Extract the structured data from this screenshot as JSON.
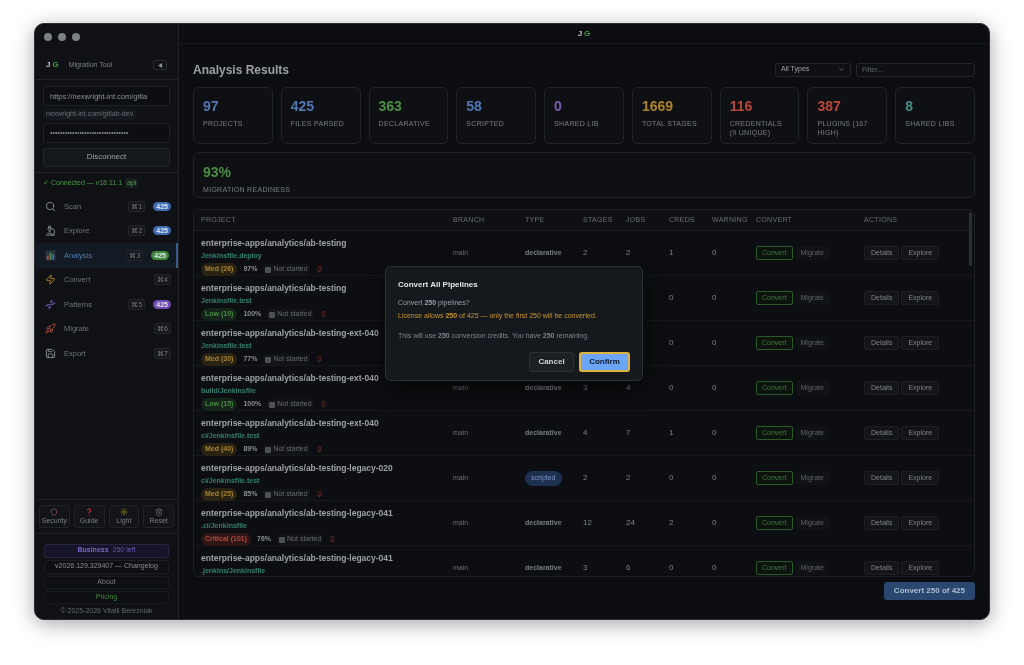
{
  "window": {
    "logo": [
      "J",
      "G"
    ]
  },
  "sidebar": {
    "logo": [
      "J",
      "G"
    ],
    "title": "Migration Tool",
    "url": "https://nexwright-int.com/gitla",
    "url_hint": "nexwright-int.com/gitlab-dev",
    "token": "••••••••••••••••••••••••••••••••",
    "disconnect": "Disconnect",
    "status": "✓ Connected — v18.11.1",
    "status_tag": "api",
    "items": [
      {
        "kind": "scan",
        "label": "Scan",
        "shortcut": "⌘1",
        "count": "425",
        "color": "#3d6bb0",
        "selected": false
      },
      {
        "kind": "explore",
        "label": "Explore",
        "shortcut": "⌘2",
        "count": "425",
        "color": "#3d6bb0",
        "selected": false
      },
      {
        "kind": "analysis",
        "label": "Analysis",
        "shortcut": "⌘3",
        "count": "425",
        "color": "#3f8a3a",
        "selected": true
      },
      {
        "kind": "convert",
        "label": "Convert",
        "shortcut": "⌘4",
        "selected": false
      },
      {
        "kind": "patterns",
        "label": "Patterns",
        "shortcut": "⌘5",
        "count": "425",
        "color": "#6e4bb0",
        "selected": false
      },
      {
        "kind": "migrate",
        "label": "Migrate",
        "shortcut": "⌘6",
        "selected": false
      },
      {
        "kind": "export",
        "label": "Export",
        "shortcut": "⌘7",
        "selected": false
      }
    ],
    "tools": [
      {
        "kind": "security",
        "label": "Security"
      },
      {
        "kind": "guide",
        "label": "Guide"
      },
      {
        "kind": "light",
        "label": "Light"
      },
      {
        "kind": "reset",
        "label": "Reset"
      }
    ],
    "plan": "Business",
    "plan_left": "250 left",
    "version": "v2026.129.329407 — Changelog",
    "about": "About",
    "pricing": "Pricing",
    "copyright": "© 2025-2026 Vitalii Berezniak"
  },
  "main": {
    "title": "Analysis Results",
    "type_filter": "All Types",
    "filter_placeholder": "Filter...",
    "stats": [
      {
        "value": "97",
        "label": "PROJECTS",
        "color": "#4f78b5"
      },
      {
        "value": "425",
        "label": "FILES PARSED",
        "color": "#4f78b5"
      },
      {
        "value": "363",
        "label": "DECLARATIVE",
        "color": "#4a8f43"
      },
      {
        "value": "58",
        "label": "SCRIPTED",
        "color": "#4f78b5"
      },
      {
        "value": "0",
        "label": "SHARED LIB",
        "color": "#7c5cb3"
      },
      {
        "value": "1669",
        "label": "TOTAL STAGES",
        "color": "#ad8525"
      },
      {
        "value": "116",
        "label": "CREDENTIALS (9 UNIQUE)",
        "color": "#b9473a"
      },
      {
        "value": "387",
        "label": "PLUGINS (167 HIGH)",
        "color": "#b9473a"
      },
      {
        "value": "8",
        "label": "SHARED LIBS",
        "color": "#3f8f86"
      }
    ],
    "readiness": {
      "value": "93%",
      "label": "MIGRATION READINESS"
    },
    "table": {
      "columns": [
        "PROJECT",
        "BRANCH",
        "TYPE",
        "STAGES",
        "JOBS",
        "CREDS",
        "WARNING",
        "CONVERT",
        "ACTIONS"
      ],
      "rows": [
        {
          "project": "enterprise-apps/analytics/ab-testing",
          "path": "Jenkinsfile.deploy",
          "risk": {
            "label": "Med (26)",
            "kind": "medium"
          },
          "readiness": "97%",
          "status": "Not started",
          "branch": "main",
          "type": {
            "label": "declarative",
            "kind": "declarative"
          },
          "stages": "2",
          "jobs": "2",
          "creds": "1",
          "warnings": "0",
          "convert": "Convert",
          "migrate": "Migrate",
          "details": "Details",
          "explore": "Explore"
        },
        {
          "project": "enterprise-apps/analytics/ab-testing",
          "path": "Jenkinsfile.test",
          "risk": {
            "label": "Low (10)",
            "kind": "low"
          },
          "readiness": "100%",
          "status": "Not started",
          "creds": "0",
          "warnings": "0",
          "convert": "Convert",
          "migrate": "Migrate",
          "details": "Details",
          "explore": "Explore"
        },
        {
          "project": "enterprise-apps/analytics/ab-testing-ext-040",
          "path": "Jenkinsfile.test",
          "risk": {
            "label": "Med (30)",
            "kind": "medium"
          },
          "readiness": "77%",
          "status": "Not started",
          "creds": "0",
          "warnings": "0",
          "convert": "Convert",
          "migrate": "Migrate",
          "details": "Details",
          "explore": "Explore"
        },
        {
          "project": "enterprise-apps/analytics/ab-testing-ext-040",
          "path": "build/Jenkinsfile",
          "risk": {
            "label": "Low (15)",
            "kind": "low"
          },
          "readiness": "100%",
          "status": "Not started",
          "branch": "main",
          "type": {
            "label": "declarative",
            "kind": "declarative"
          },
          "stages": "3",
          "jobs": "4",
          "creds": "0",
          "warnings": "0",
          "convert": "Convert",
          "migrate": "Migrate",
          "details": "Details",
          "explore": "Explore"
        },
        {
          "project": "enterprise-apps/analytics/ab-testing-ext-040",
          "path": "ci/Jenkinsfile.test",
          "risk": {
            "label": "Med (40)",
            "kind": "medium"
          },
          "readiness": "89%",
          "status": "Not started",
          "branch": "main",
          "type": {
            "label": "declarative",
            "kind": "declarative"
          },
          "stages": "4",
          "jobs": "7",
          "creds": "1",
          "warnings": "0",
          "convert": "Convert",
          "migrate": "Migrate",
          "details": "Details",
          "explore": "Explore"
        },
        {
          "project": "enterprise-apps/analytics/ab-testing-legacy-020",
          "path": "ci/Jenkinsfile.test",
          "risk": {
            "label": "Med (25)",
            "kind": "medium"
          },
          "readiness": "85%",
          "status": "Not started",
          "branch": "main",
          "type": {
            "label": "scripted",
            "kind": "scripted"
          },
          "stages": "2",
          "jobs": "2",
          "creds": "0",
          "warnings": "0",
          "convert": "Convert",
          "migrate": "Migrate",
          "details": "Details",
          "explore": "Explore"
        },
        {
          "project": "enterprise-apps/analytics/ab-testing-legacy-041",
          "path": ".ci/Jenkinsfile",
          "risk": {
            "label": "Critical (101)",
            "kind": "critical"
          },
          "readiness": "76%",
          "status": "Not started",
          "branch": "main",
          "type": {
            "label": "declarative",
            "kind": "declarative"
          },
          "stages": "12",
          "jobs": "24",
          "creds": "2",
          "warnings": "0",
          "convert": "Convert",
          "migrate": "Migrate",
          "details": "Details",
          "explore": "Explore"
        },
        {
          "project": "enterprise-apps/analytics/ab-testing-legacy-041",
          "path": ".jenkins/Jenkinsfile",
          "branch": "main",
          "type": {
            "label": "declarative",
            "kind": "declarative"
          },
          "stages": "3",
          "jobs": "6",
          "creds": "0",
          "warnings": "0",
          "convert": "Convert",
          "migrate": "Migrate",
          "details": "Details",
          "explore": "Explore"
        }
      ]
    },
    "convert_all": "Convert 250 of 425"
  },
  "dialog": {
    "title": "Convert All Pipelines",
    "question": "Convert **250** pipelines?",
    "warning": "License allows **250** of 425 — only the first 250 will be converted.",
    "note": "This will use **250** conversion credits. You have **250** remaining.",
    "cancel": "Cancel",
    "confirm": "Confirm",
    "confirm_focused": true
  }
}
